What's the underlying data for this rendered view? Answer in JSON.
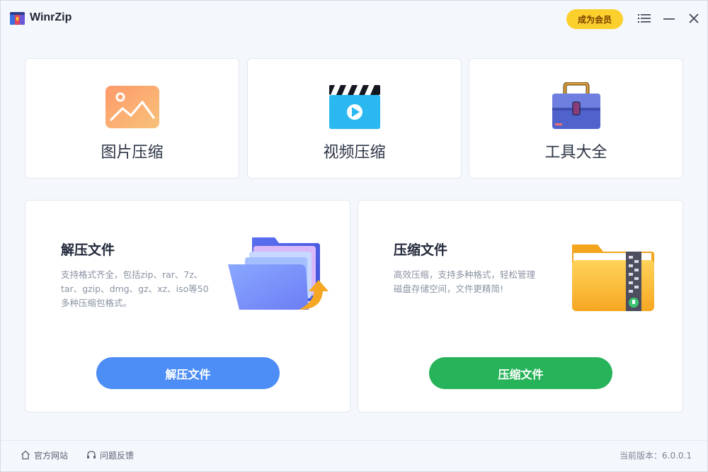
{
  "app": {
    "title": "WinrZip",
    "vip_label": "成为会员"
  },
  "icons": {
    "logo": "winrzip-logo-icon",
    "menu": "list-menu-icon",
    "minimize": "minimize-icon",
    "close": "close-icon"
  },
  "top_cards": [
    {
      "label": "图片压缩",
      "icon": "image-icon"
    },
    {
      "label": "视频压缩",
      "icon": "video-clapper-icon"
    },
    {
      "label": "工具大全",
      "icon": "toolbox-icon"
    }
  ],
  "extract": {
    "title": "解压文件",
    "description": "支持格式齐全，包括zip、rar、7z、tar、gzip、dmg、gz、xz、iso等50多种压缩包格式。",
    "button": "解压文件",
    "color": "#4c8df6"
  },
  "compress": {
    "title": "压缩文件",
    "description": "高效压缩，支持多种格式，轻松管理磁盘存储空间，文件更精简!",
    "button": "压缩文件",
    "color": "#27b35a"
  },
  "footer": {
    "site": "官方网站",
    "feedback": "问题反馈",
    "version": "当前版本：6.0.0.1"
  }
}
